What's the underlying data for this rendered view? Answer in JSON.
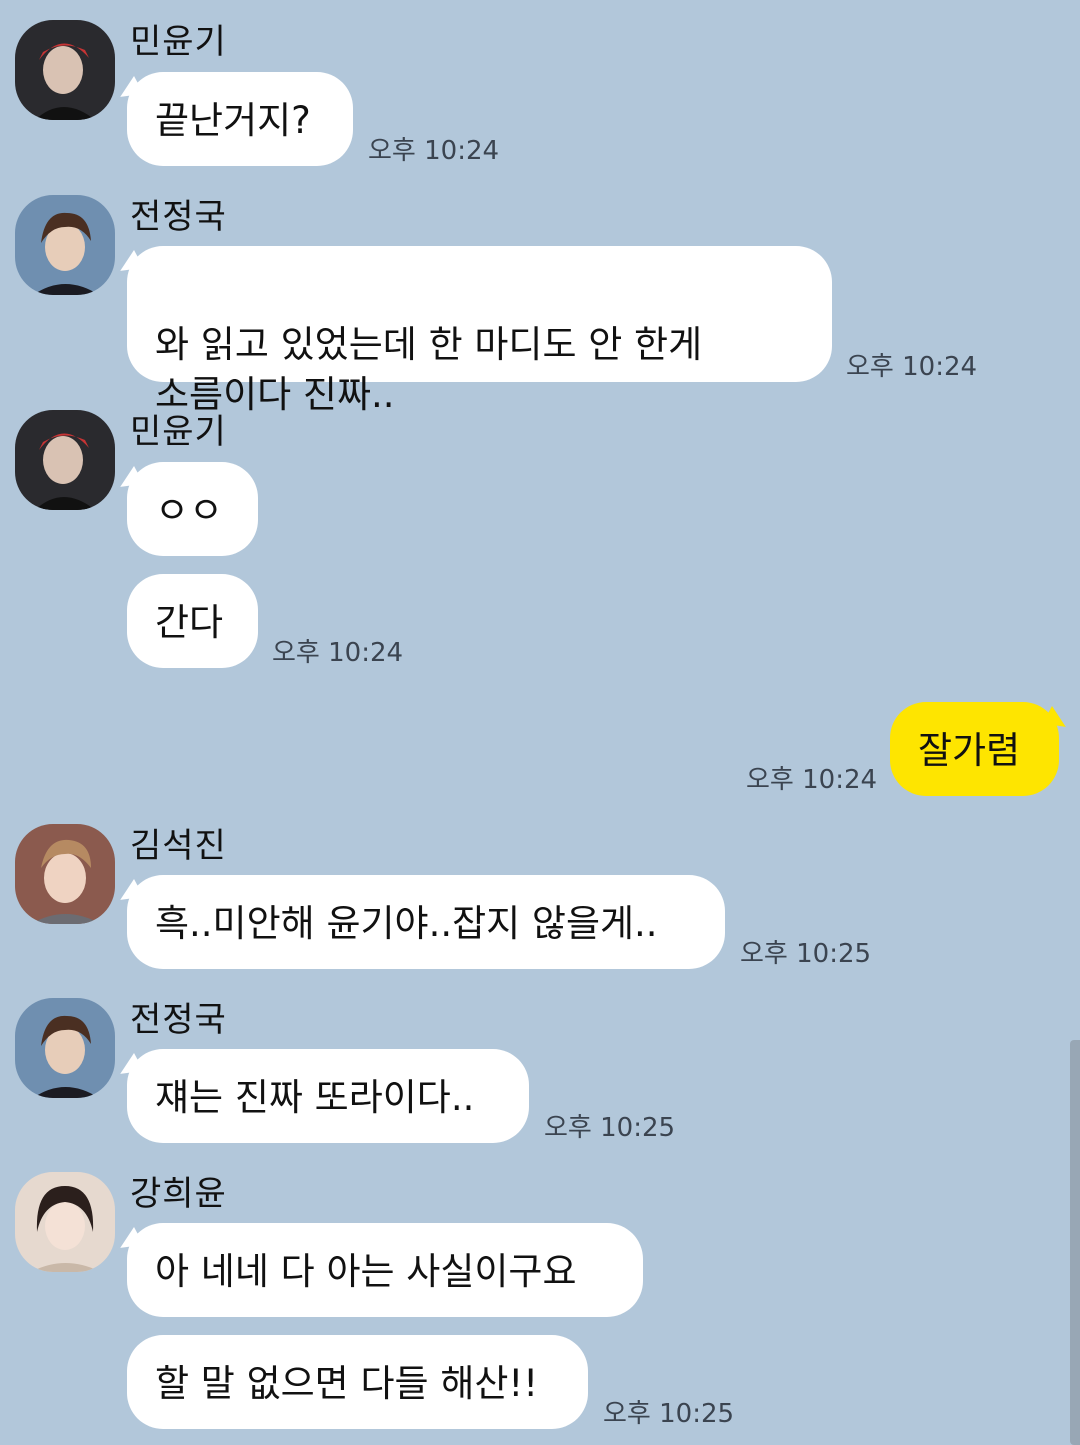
{
  "messages": [
    {
      "sender": "민윤기",
      "texts": [
        "끝난거지?"
      ],
      "time": "오후 10:24"
    },
    {
      "sender": "전정국",
      "texts": [
        "와 읽고 있었는데 한 마디도 안 한게\n소름이다 진짜.."
      ],
      "time": "오후 10:24"
    },
    {
      "sender": "민윤기",
      "texts": [
        "ㅇㅇ",
        "간다"
      ],
      "time": "오후 10:24"
    },
    {
      "sender": "me",
      "texts": [
        "잘가렴"
      ],
      "time": "오후 10:24"
    },
    {
      "sender": "김석진",
      "texts": [
        "흑..미안해 윤기야..잡지 않을게.."
      ],
      "time": "오후 10:25"
    },
    {
      "sender": "전정국",
      "texts": [
        "쟤는 진짜 또라이다.."
      ],
      "time": "오후 10:25"
    },
    {
      "sender": "강희윤",
      "texts": [
        "아 네네 다 아는 사실이구요",
        "할 말 없으면 다들 해산!!"
      ],
      "time": "오후 10:25"
    }
  ],
  "colors": {
    "background": "#b2c7da",
    "incoming_bubble": "#ffffff",
    "outgoing_bubble": "#fee500"
  }
}
